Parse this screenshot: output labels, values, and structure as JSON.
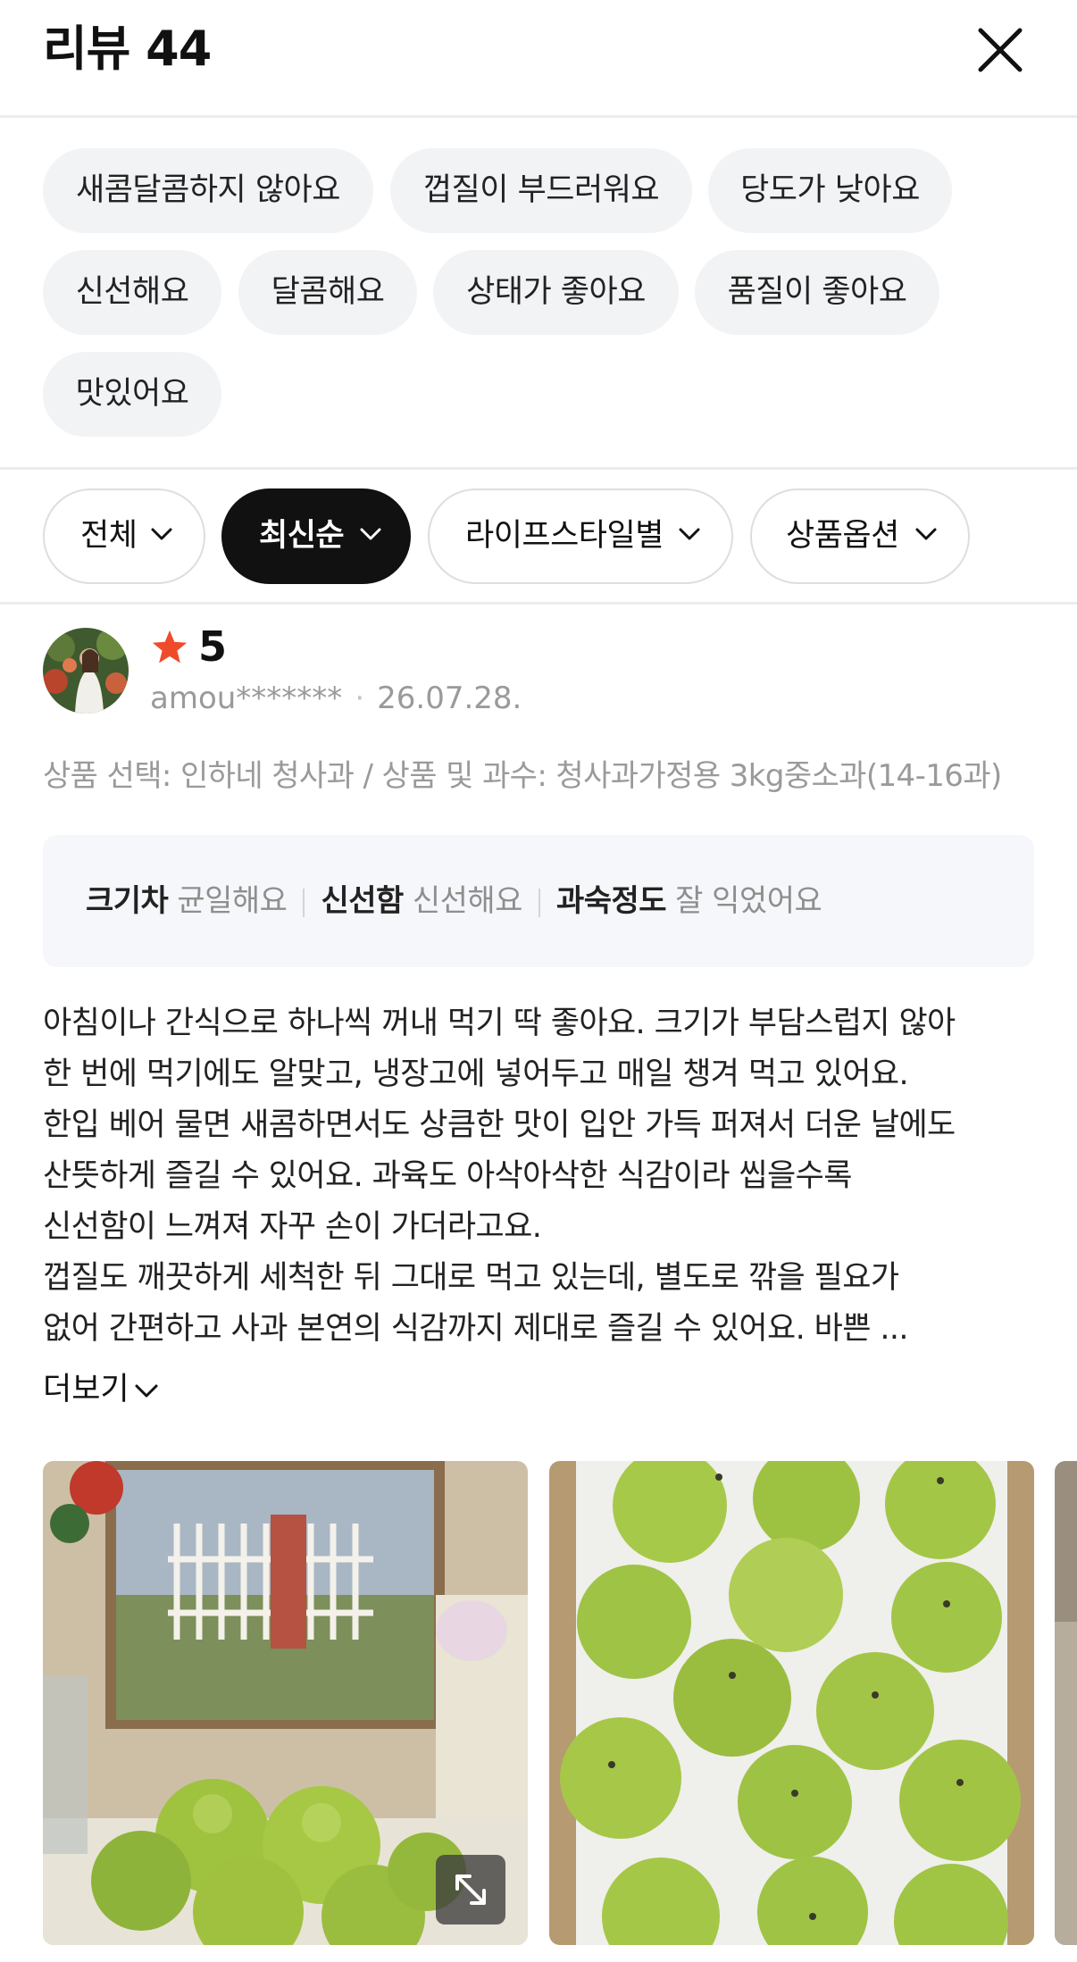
{
  "header": {
    "title": "리뷰 44",
    "close_icon": "close-icon"
  },
  "keywords": [
    "새콤달콤하지 않아요",
    "껍질이 부드러워요",
    "당도가 낮아요",
    "신선해요",
    "달콤해요",
    "상태가 좋아요",
    "품질이 좋아요",
    "맛있어요"
  ],
  "filters": [
    {
      "label": "전체",
      "active": false
    },
    {
      "label": "최신순",
      "active": true
    },
    {
      "label": "라이프스타일별",
      "active": false
    },
    {
      "label": "상품옵션",
      "active": false
    }
  ],
  "review": {
    "rating": "5",
    "star_color": "#ef4b2b",
    "user": "amou*******",
    "date": "26.07.28.",
    "option": "상품 선택: 인하네 청사과 / 상품 및 과수: 청사과가정용 3kg중소과(14-16과)",
    "summary": [
      {
        "key": "크기차",
        "value": "균일해요"
      },
      {
        "key": "신선함",
        "value": "신선해요"
      },
      {
        "key": "과숙정도",
        "value": "잘 익었어요"
      }
    ],
    "body_lines": [
      "아침이나 간식으로 하나씩 꺼내 먹기 딱 좋아요. 크기가 부담스럽지 않아",
      "한 번에 먹기에도 알맞고, 냉장고에 넣어두고 매일 챙겨 먹고 있어요.",
      "한입 베어 물면 새콤하면서도 상큼한 맛이 입안 가득 퍼져서 더운 날에도",
      "산뜻하게 즐길 수 있어요. 과육도 아삭아삭한 식감이라 씹을수록",
      "신선함이 느껴져 자꾸 손이 가더라고요.",
      "껍질도 깨끗하게 세척한 뒤 그대로 먹고 있는데, 별도로 깎을 필요가",
      "없어 간편하고 사과 본연의 식감까지 제대로 즐길 수 있어요. 바쁜 ..."
    ],
    "more_label": "더보기"
  }
}
